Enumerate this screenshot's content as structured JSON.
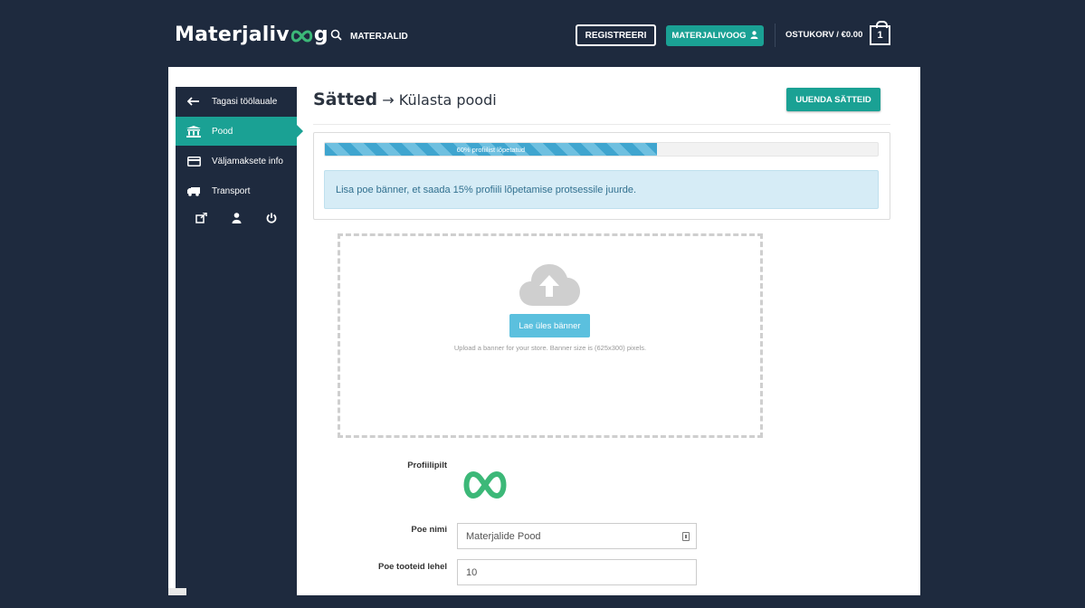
{
  "navbar": {
    "logo_text": "Materjaliv",
    "logo_suffix": "g",
    "search_label": "MATERJALID",
    "register_label": "REGISTREERI",
    "account_label": "MATERJALIVOOG",
    "cart_label": "OSTUKORV / €0.00",
    "cart_count": "1"
  },
  "sidebar": {
    "items": [
      {
        "label": "Tagasi töölauale",
        "icon": "arrow-left-icon"
      },
      {
        "label": "Pood",
        "icon": "bank-icon"
      },
      {
        "label": "Väljamaksete info",
        "icon": "credit-card-icon"
      },
      {
        "label": "Transport",
        "icon": "truck-icon"
      }
    ],
    "active_index": 1,
    "bottom_icons": [
      "external-link-icon",
      "user-icon",
      "power-icon"
    ]
  },
  "header": {
    "title": "Sätted",
    "subtitle": "→ Külasta poodi",
    "update_button": "UUENDA SÄTTEID"
  },
  "progress": {
    "label": "60% profiilist lõpetatud",
    "percent": 60
  },
  "alert": {
    "text": "Lisa poe bänner, et saada 15% profiili lõpetamise protsessile juurde."
  },
  "upload": {
    "button_label": "Lae üles bänner",
    "hint": "Upload a banner for your store. Banner size is (625x300) pixels."
  },
  "form": {
    "profile_picture_label": "Profiilipilt",
    "store_name_label": "Poe nimi",
    "store_name_value": "Materjalide Pood",
    "products_per_page_label": "Poe tooteid lehel",
    "products_per_page_value": "10"
  },
  "colors": {
    "navy": "#1e2a3e",
    "teal": "#1aa194",
    "info_blue": "#5bc0de",
    "logo_green": "#3cb878"
  }
}
